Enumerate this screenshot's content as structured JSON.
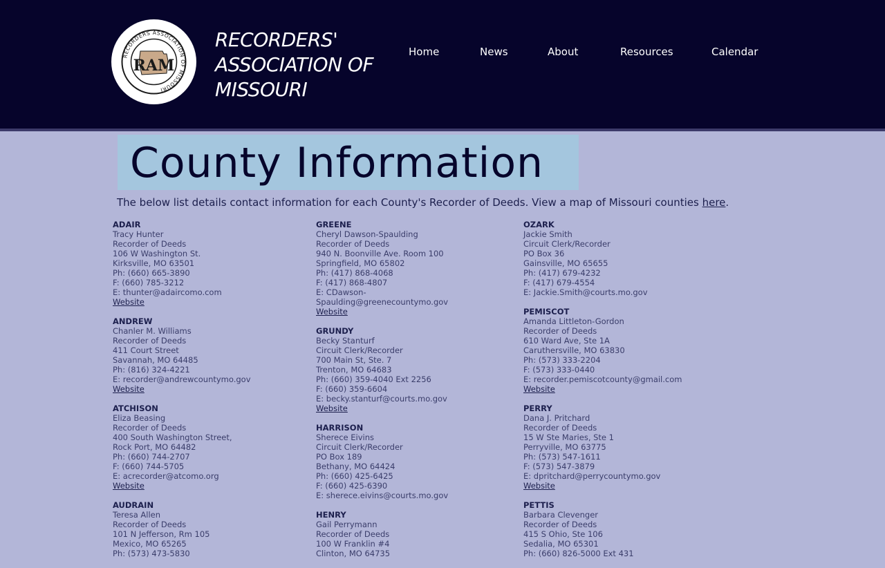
{
  "header": {
    "logo_letters": "RAM",
    "logo_ring_text": "RECORDERS ASSOCIATION OF MISSOURI",
    "title_lines": [
      "RECORDERS'",
      "ASSOCIATION OF",
      "MISSOURI"
    ],
    "nav": [
      "Home",
      "News",
      "About",
      "Resources",
      "Calendar"
    ]
  },
  "main": {
    "title": "County Information",
    "intro_text": "The below list details contact information for each County's Recorder of Deeds. View a map of Missouri counties ",
    "intro_link": "here",
    "intro_end": "."
  },
  "columns": [
    [
      {
        "county": "ADAIR",
        "lines": [
          "Tracy Hunter",
          "Recorder of Deeds",
          "106 W Washington St.",
          "Kirksville, MO 63501",
          "Ph: (660) 665-3890",
          "F: (660) 785-3212",
          "E: thunter@adaircomo.com"
        ],
        "website": "Website"
      },
      {
        "county": "ANDREW",
        "lines": [
          "Chanler M. Williams",
          "Recorder of Deeds",
          "411 Court Street",
          "Savannah, MO 64485",
          "Ph: (816) 324-4221",
          "E: recorder@andrewcountymo.gov"
        ],
        "website": "Website"
      },
      {
        "county": "ATCHISON",
        "lines": [
          "Eliza Beasing",
          "Recorder of Deeds",
          "400 South Washington Street,",
          "Rock Port, MO 64482",
          "Ph: (660) 744-2707",
          "F: (660) 744-5705",
          "E: acrecorder@atcomo.org"
        ],
        "website": "Website"
      },
      {
        "county": "AUDRAIN",
        "lines": [
          "Teresa Allen",
          "Recorder of Deeds",
          "101 N Jefferson,  Rm 105",
          "Mexico, MO 65265",
          "Ph: (573) 473-5830"
        ],
        "website": ""
      }
    ],
    [
      {
        "county": "GREENE",
        "lines": [
          "Cheryl Dawson-Spaulding",
          "Recorder of Deeds",
          "940 N. Boonville Ave. Room 100",
          "Springfield, MO 65802",
          "Ph: (417) 868-4068",
          "F: (417) 868-4807",
          "E: CDawson-",
          "Spaulding@greenecountymo.gov"
        ],
        "website": "Website"
      },
      {
        "county": "GRUNDY",
        "lines": [
          "Becky Stanturf",
          "Circuit Clerk/Recorder",
          "700 Main St, Ste. 7",
          "Trenton, MO 64683",
          "Ph: (660) 359-4040 Ext 2256",
          "F: (660) 359-6604",
          "E: becky.stanturf@courts.mo.gov"
        ],
        "website": "Website"
      },
      {
        "county": "HARRISON",
        "lines": [
          "Sherece Eivins",
          "Circuit Clerk/Recorder",
          "PO Box 189",
          "Bethany, MO 64424",
          "Ph: (660) 425-6425",
          "F: (660) 425-6390",
          "E: sherece.eivins@courts.mo.gov"
        ],
        "website": ""
      },
      {
        "county": "HENRY",
        "lines": [
          "Gail Perrymann",
          "Recorder of Deeds",
          "100 W Franklin #4",
          "Clinton, MO 64735"
        ],
        "website": ""
      }
    ],
    [
      {
        "county": "OZARK",
        "lines": [
          "Jackie Smith",
          "Circuit Clerk/Recorder",
          "PO Box 36",
          "Gainsville, MO 65655",
          "Ph: (417) 679-4232",
          "F: (417) 679-4554",
          "E: Jackie.Smith@courts.mo.gov"
        ],
        "website": ""
      },
      {
        "county": "PEMISCOT",
        "lines": [
          "Amanda Littleton-Gordon",
          "Recorder of Deeds",
          "610 Ward Ave, Ste 1A",
          "Caruthersville, MO 63830",
          "Ph: (573) 333-2204",
          "F: (573) 333-0440",
          "E: recorder.pemiscotcounty@gmail.com"
        ],
        "website": "Website"
      },
      {
        "county": "PERRY",
        "lines": [
          "Dana J. Pritchard",
          "Recorder of Deeds",
          "15 W Ste Maries, Ste 1",
          "Perryville, MO 63775",
          "Ph: (573) 547-1611",
          "F: (573) 547-3879",
          "E:  dpritchard@perrycountymo.gov"
        ],
        "website": "Website"
      },
      {
        "county": "PETTIS",
        "lines": [
          "Barbara Clevenger",
          "Recorder of Deeds",
          "415 S Ohio, Ste 106",
          "Sedalia, MO 65301",
          "Ph: (660) 826-5000 Ext 431"
        ],
        "website": ""
      }
    ]
  ]
}
